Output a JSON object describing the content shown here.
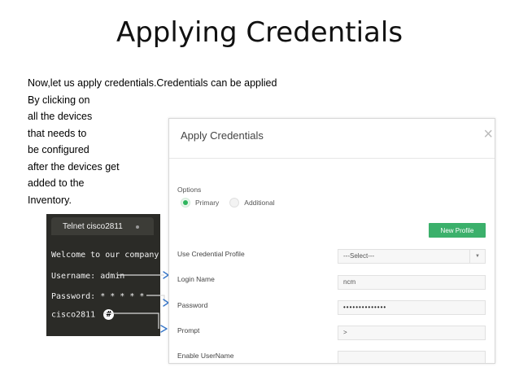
{
  "slide": {
    "title": "Applying Credentials",
    "body_lines": [
      "Now,let us apply credentials.Credentials can be applied",
      "By clicking on",
      "all the devices",
      "that needs to",
      "be configured",
      "after the devices get",
      "added to the",
      "Inventory."
    ]
  },
  "terminal": {
    "tab_title": "Telnet cisco2811",
    "lines": {
      "welcome": "Welcome to our company",
      "username": "Username: admin",
      "password": "Password: * * * * *",
      "prompt_host": "cisco2811",
      "prompt_symbol": "#"
    }
  },
  "dialog": {
    "title": "Apply Credentials",
    "close_glyph": "×",
    "options_label": "Options",
    "radio_primary": "Primary",
    "radio_additional": "Additional",
    "new_profile_button": "New Profile",
    "fields": {
      "profile_label": "Use Credential Profile",
      "profile_value": "---Select---",
      "login_label": "Login Name",
      "login_value": "ncm",
      "password_label": "Password",
      "password_value": "••••••••••••••",
      "prompt_label": "Prompt",
      "prompt_value": ">",
      "enable_user_label": "Enable UserName",
      "enable_user_value": ""
    }
  },
  "colors": {
    "accent_green": "#3bb06b",
    "terminal_bg": "#2b2b27",
    "arrow_blue": "#3a78c9"
  }
}
